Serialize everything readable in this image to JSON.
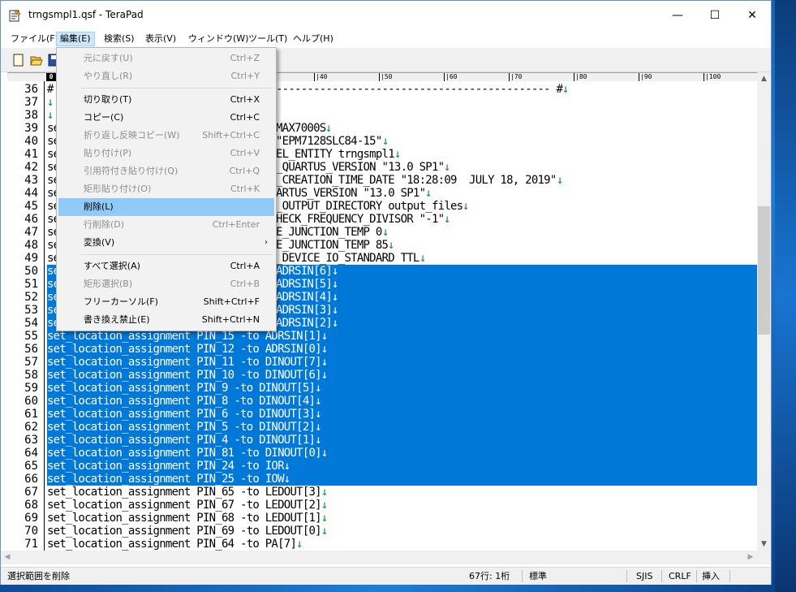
{
  "window": {
    "title": "trngsmpl1.qsf - TeraPad",
    "controls": {
      "minimize": "—",
      "maximize": "☐",
      "close": "✕"
    }
  },
  "menubar": [
    {
      "label": "ファイル(F)",
      "active": false
    },
    {
      "label": "編集(E)",
      "active": true
    },
    {
      "label": "検索(S)",
      "active": false
    },
    {
      "label": "表示(V)",
      "active": false
    },
    {
      "label": "ウィンドウ(W)",
      "active": false
    },
    {
      "label": "ツール(T)",
      "active": false
    },
    {
      "label": "ヘルプ(H)",
      "active": false
    }
  ],
  "edit_menu": [
    {
      "label": "元に戻す(U)",
      "shortcut": "Ctrl+Z",
      "disabled": true
    },
    {
      "label": "やり直し(R)",
      "shortcut": "Ctrl+Y",
      "disabled": true
    },
    {
      "separator": true
    },
    {
      "label": "切り取り(T)",
      "shortcut": "Ctrl+X",
      "disabled": false
    },
    {
      "label": "コピー(C)",
      "shortcut": "Ctrl+C",
      "disabled": false
    },
    {
      "label": "折り返し反映コピー(W)",
      "shortcut": "Shift+Ctrl+C",
      "disabled": true
    },
    {
      "label": "貼り付け(P)",
      "shortcut": "Ctrl+V",
      "disabled": true
    },
    {
      "label": "引用符付き貼り付け(Q)",
      "shortcut": "Ctrl+Q",
      "disabled": true
    },
    {
      "label": "矩形貼り付け(O)",
      "shortcut": "Ctrl+K",
      "disabled": true
    },
    {
      "label": "削除(L)",
      "shortcut": "",
      "disabled": false,
      "hover": true
    },
    {
      "label": "行削除(D)",
      "shortcut": "Ctrl+Enter",
      "disabled": true
    },
    {
      "label": "変換(V)",
      "shortcut": "",
      "disabled": false,
      "submenu": true
    },
    {
      "separator": true
    },
    {
      "label": "すべて選択(A)",
      "shortcut": "Ctrl+A",
      "disabled": false
    },
    {
      "label": "矩形選択(B)",
      "shortcut": "Ctrl+B",
      "disabled": true
    },
    {
      "label": "フリーカーソル(F)",
      "shortcut": "Shift+Ctrl+F",
      "disabled": false
    },
    {
      "label": "書き換え禁止(E)",
      "shortcut": "Shift+Ctrl+N",
      "disabled": false
    }
  ],
  "ruler": {
    "first": "0",
    "marks": [
      "|40",
      "|50",
      "|60",
      "|70",
      "|80",
      "|90",
      "|100"
    ]
  },
  "editor": {
    "eol_mark": "↓",
    "lines": [
      {
        "n": "36",
        "text": "#",
        "tail": "-------------------------------------------- #",
        "eol": true,
        "selected": false
      },
      {
        "n": "37",
        "text": "",
        "tail": "",
        "eol": true,
        "selected": false
      },
      {
        "n": "38",
        "text": "",
        "tail": "",
        "eol": true,
        "selected": false
      },
      {
        "n": "39",
        "text": "se",
        "tail": "MAX7000S",
        "eol": true,
        "selected": false
      },
      {
        "n": "40",
        "text": "se",
        "tail": "\"EPM7128SLC84-15\"",
        "eol": true,
        "selected": false
      },
      {
        "n": "41",
        "text": "se",
        "tail": "EL_ENTITY trngsmpl1",
        "eol": true,
        "selected": false
      },
      {
        "n": "42",
        "text": "se",
        "tail": "_QUARTUS_VERSION \"13.0 SP1\"",
        "eol": true,
        "selected": false
      },
      {
        "n": "43",
        "text": "se",
        "tail": "_CREATION_TIME_DATE \"18:28:09  JULY 18, 2019\"",
        "eol": true,
        "selected": false
      },
      {
        "n": "44",
        "text": "se",
        "tail": "ARTUS_VERSION \"13.0 SP1\"",
        "eol": true,
        "selected": false
      },
      {
        "n": "45",
        "text": "se",
        "tail": "_OUTPUT_DIRECTORY output_files",
        "eol": true,
        "selected": false
      },
      {
        "n": "46",
        "text": "se",
        "tail": "HECK_FREQUENCY_DIVISOR \"-1\"",
        "eol": true,
        "selected": false
      },
      {
        "n": "47",
        "text": "se",
        "tail": "E_JUNCTION_TEMP 0",
        "eol": true,
        "selected": false
      },
      {
        "n": "48",
        "text": "se",
        "tail": "E_JUNCTION_TEMP 85",
        "eol": true,
        "selected": false
      },
      {
        "n": "49",
        "text": "se",
        "tail": "_DEVICE_IO_STANDARD TTL",
        "eol": true,
        "selected": false
      },
      {
        "n": "50",
        "text": "se",
        "tail": "ADRSIN[6]",
        "eol": true,
        "selected": true
      },
      {
        "n": "51",
        "text": "se",
        "tail": "ADRSIN[5]",
        "eol": true,
        "selected": true
      },
      {
        "n": "52",
        "text": "se",
        "tail": "ADRSIN[4]",
        "eol": true,
        "selected": true
      },
      {
        "n": "53",
        "text": "se",
        "tail": "ADRSIN[3]",
        "eol": true,
        "selected": true
      },
      {
        "n": "54",
        "text": "se",
        "tail": "ADRSIN[2]",
        "eol": true,
        "selected": true
      },
      {
        "n": "55",
        "text": "set_location_assignment PIN_15 -to ADRSIN[1]",
        "tail": "",
        "eol": true,
        "selected": true
      },
      {
        "n": "56",
        "text": "set_location_assignment PIN_12 -to ADRSIN[0]",
        "tail": "",
        "eol": true,
        "selected": true
      },
      {
        "n": "57",
        "text": "set_location_assignment PIN_11 -to DINOUT[7]",
        "tail": "",
        "eol": true,
        "selected": true
      },
      {
        "n": "58",
        "text": "set_location_assignment PIN_10 -to DINOUT[6]",
        "tail": "",
        "eol": true,
        "selected": true
      },
      {
        "n": "59",
        "text": "set_location_assignment PIN_9 -to DINOUT[5]",
        "tail": "",
        "eol": true,
        "selected": true
      },
      {
        "n": "60",
        "text": "set_location_assignment PIN_8 -to DINOUT[4]",
        "tail": "",
        "eol": true,
        "selected": true
      },
      {
        "n": "61",
        "text": "set_location_assignment PIN_6 -to DINOUT[3]",
        "tail": "",
        "eol": true,
        "selected": true
      },
      {
        "n": "62",
        "text": "set_location_assignment PIN_5 -to DINOUT[2]",
        "tail": "",
        "eol": true,
        "selected": true
      },
      {
        "n": "63",
        "text": "set_location_assignment PIN_4 -to DINOUT[1]",
        "tail": "",
        "eol": true,
        "selected": true
      },
      {
        "n": "64",
        "text": "set_location_assignment PIN_81 -to DINOUT[0]",
        "tail": "",
        "eol": true,
        "selected": true
      },
      {
        "n": "65",
        "text": "set_location_assignment PIN_24 -to IOR",
        "tail": "",
        "eol": true,
        "selected": true
      },
      {
        "n": "66",
        "text": "set_location_assignment PIN_25 -to IOW",
        "tail": "",
        "eol": true,
        "selected": true
      },
      {
        "n": "67",
        "text": "set_location_assignment PIN_65 -to LEDOUT[3]",
        "tail": "",
        "eol": true,
        "selected": false
      },
      {
        "n": "68",
        "text": "set_location_assignment PIN_67 -to LEDOUT[2]",
        "tail": "",
        "eol": true,
        "selected": false
      },
      {
        "n": "69",
        "text": "set_location_assignment PIN_68 -to LEDOUT[1]",
        "tail": "",
        "eol": true,
        "selected": false
      },
      {
        "n": "70",
        "text": "set_location_assignment PIN_69 -to LEDOUT[0]",
        "tail": "",
        "eol": true,
        "selected": false
      },
      {
        "n": "71",
        "text": "set_location_assignment PIN_64 -to PA[7]",
        "tail": "",
        "eol": true,
        "selected": false
      }
    ]
  },
  "statusbar": {
    "message": "選択範囲を削除",
    "position": "67行:   1桁",
    "mode": "標準",
    "encoding": "SJIS",
    "line_ending": "CRLF",
    "insert_mode": "挿入"
  }
}
